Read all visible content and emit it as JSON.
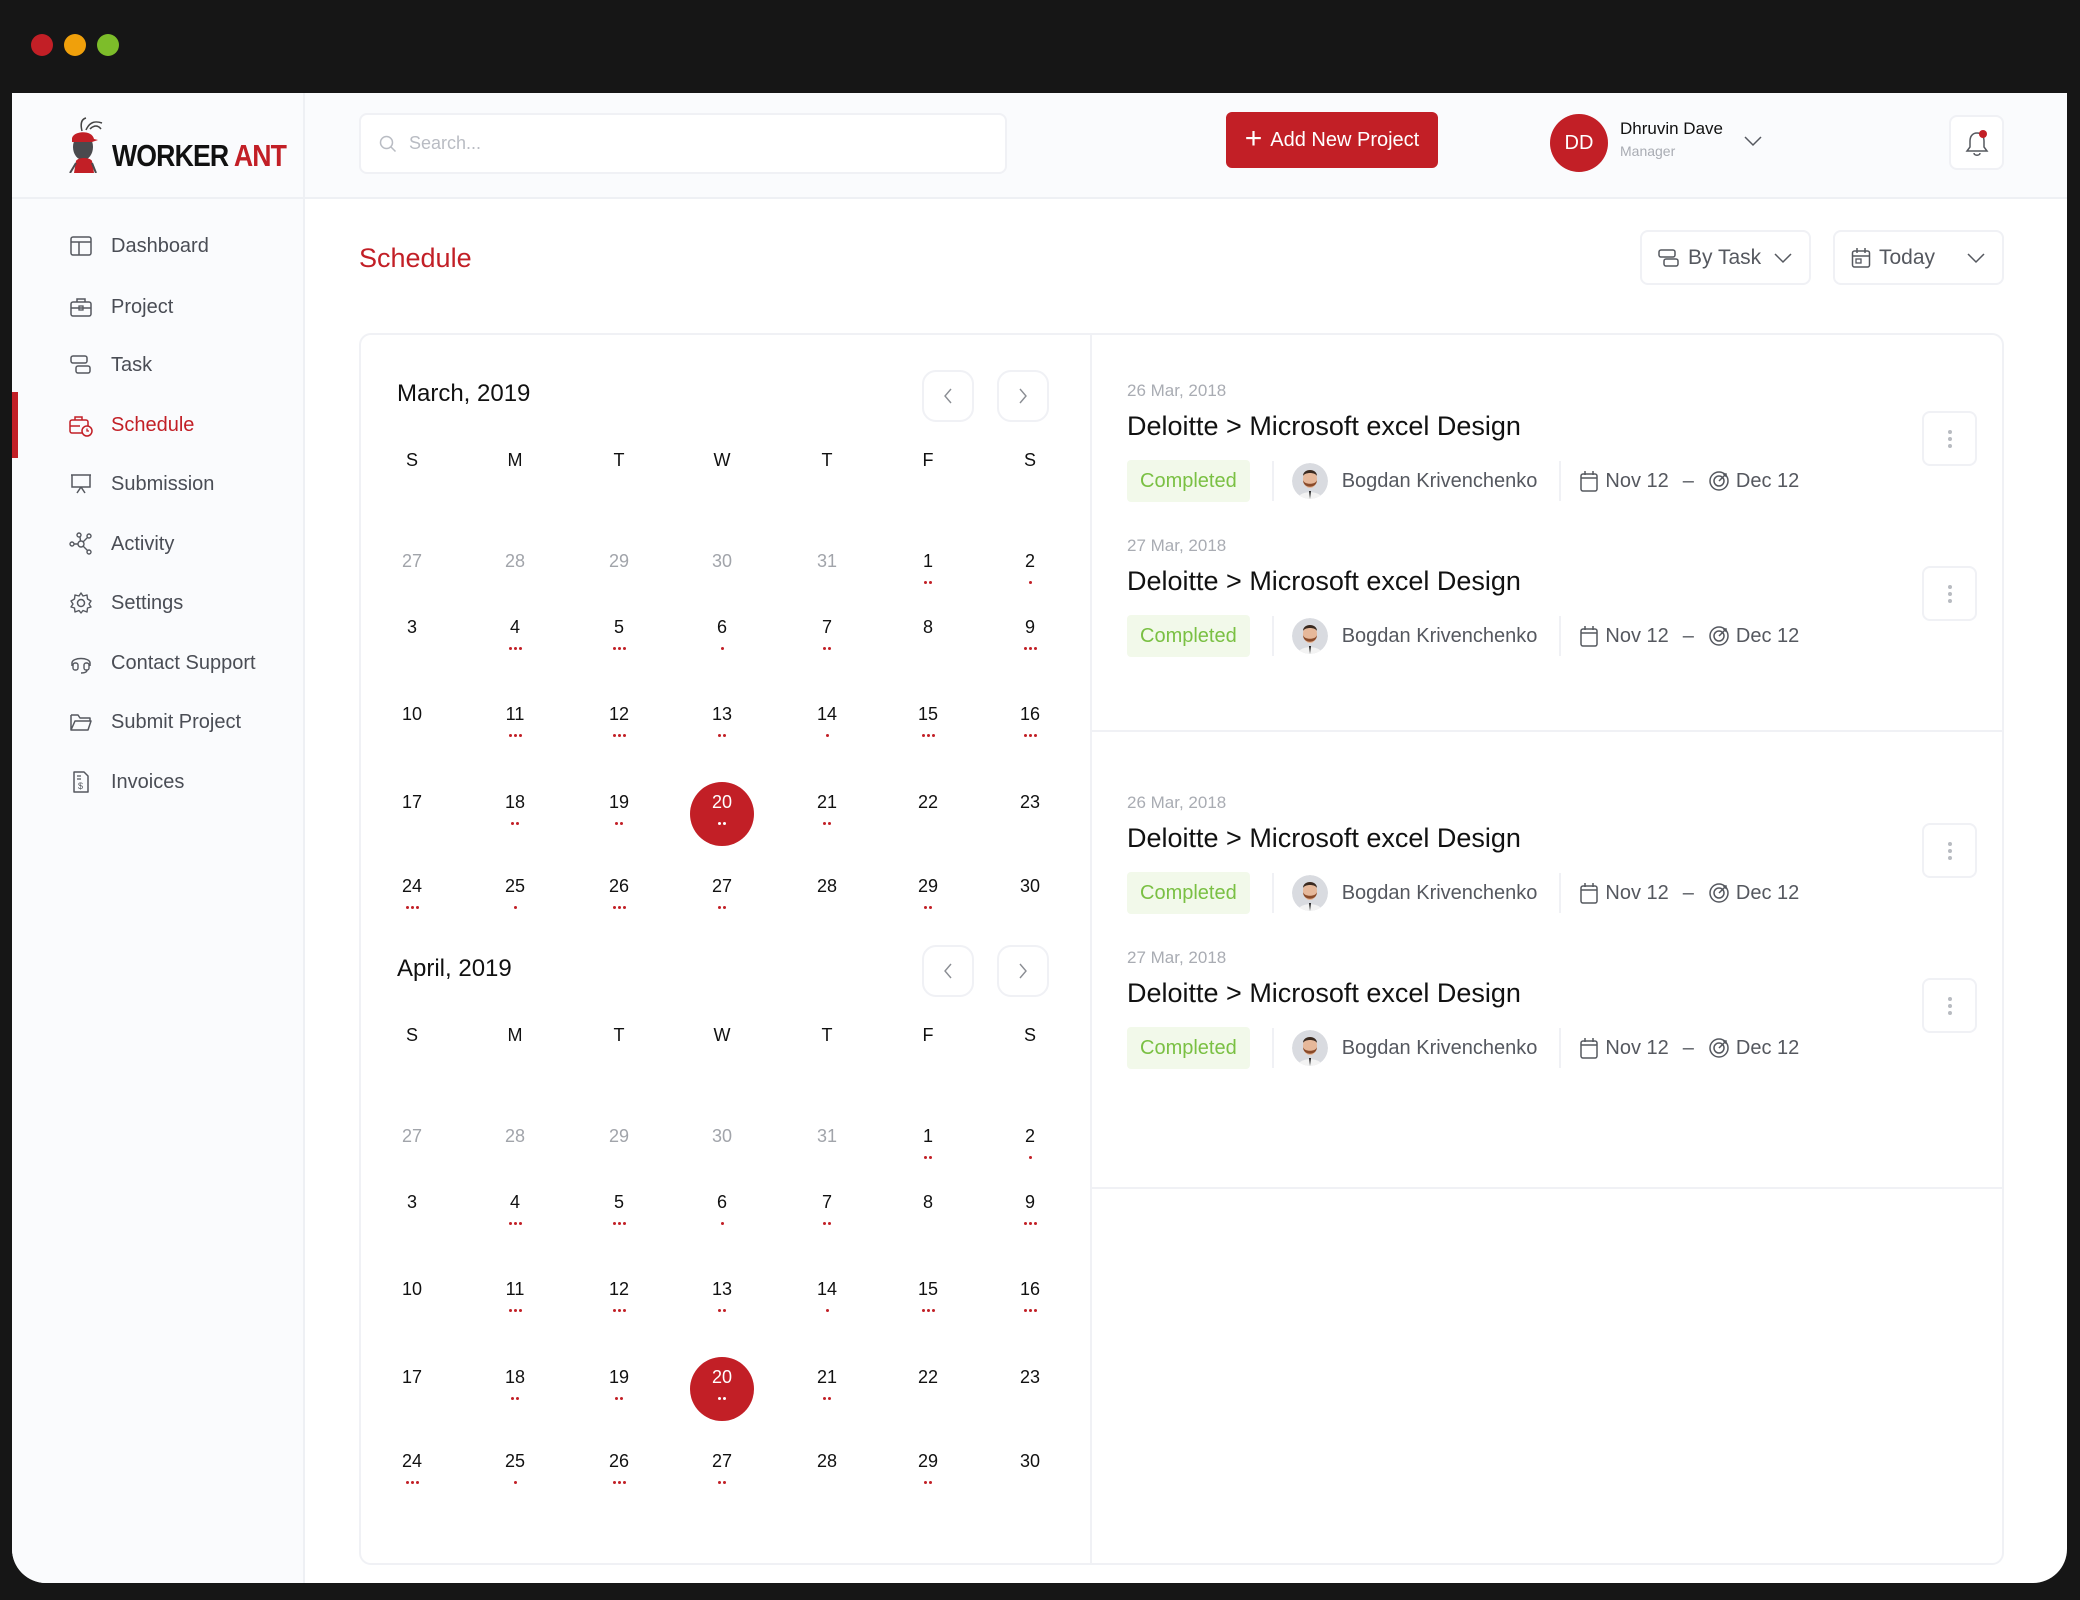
{
  "window": {
    "traffic_lights": [
      {
        "name": "close",
        "color": "#c21f26"
      },
      {
        "name": "minimize",
        "color": "#f0a00b"
      },
      {
        "name": "maximize",
        "color": "#7dbd2a"
      }
    ]
  },
  "brand": {
    "name_part1": "WORKER",
    "name_part2": "ANT",
    "accent": "#c21f26"
  },
  "header": {
    "search_placeholder": "Search...",
    "add_button_label": "Add New Project",
    "user": {
      "initials": "DD",
      "name": "Dhruvin Dave",
      "role": "Manager"
    },
    "notifications_unread": true
  },
  "sidebar": {
    "active": "Schedule",
    "items": [
      {
        "label": "Dashboard",
        "icon": "dashboard-icon"
      },
      {
        "label": "Project",
        "icon": "briefcase-icon"
      },
      {
        "label": "Task",
        "icon": "task-icon"
      },
      {
        "label": "Schedule",
        "icon": "schedule-icon"
      },
      {
        "label": "Submission",
        "icon": "presentation-icon"
      },
      {
        "label": "Activity",
        "icon": "network-icon"
      },
      {
        "label": "Settings",
        "icon": "gear-icon"
      },
      {
        "label": "Contact Support",
        "icon": "headset-icon"
      },
      {
        "label": "Submit Project",
        "icon": "folder-icon"
      },
      {
        "label": "Invoices",
        "icon": "invoice-icon"
      }
    ]
  },
  "main": {
    "title": "Schedule",
    "filters": {
      "group_by": "By Task",
      "range": "Today"
    }
  },
  "calendar": {
    "weekdays": [
      "S",
      "M",
      "T",
      "W",
      "T",
      "F",
      "S"
    ],
    "months": [
      {
        "title": "March, 2019",
        "selected_day": 20,
        "leading_days": [
          27,
          28,
          29,
          30,
          31
        ],
        "days_in_month": 30,
        "event_dots": {
          "1": 2,
          "2": 1,
          "4": 3,
          "5": 3,
          "6": 1,
          "7": 2,
          "9": 3,
          "11": 3,
          "12": 3,
          "13": 2,
          "14": 1,
          "15": 3,
          "16": 3,
          "18": 2,
          "19": 2,
          "20": 2,
          "21": 2,
          "24": 3,
          "25": 1,
          "26": 3,
          "27": 2,
          "29": 2
        }
      },
      {
        "title": "April, 2019",
        "selected_day": 20,
        "leading_days": [
          27,
          28,
          29,
          30,
          31
        ],
        "days_in_month": 30,
        "event_dots": {
          "1": 2,
          "2": 1,
          "4": 3,
          "5": 3,
          "6": 1,
          "7": 2,
          "9": 3,
          "11": 3,
          "12": 3,
          "13": 2,
          "14": 1,
          "15": 3,
          "16": 3,
          "18": 2,
          "19": 2,
          "20": 2,
          "21": 2,
          "24": 3,
          "25": 1,
          "26": 3,
          "27": 2,
          "29": 2
        }
      }
    ]
  },
  "tasks": [
    {
      "date": "26 Mar, 2018",
      "title": "Deloitte > Microsoft excel Design",
      "status": "Completed",
      "assignee": "Bogdan Krivenchenko",
      "start": "Nov 12",
      "end": "Dec 12"
    },
    {
      "date": "27 Mar, 2018",
      "title": "Deloitte > Microsoft excel Design",
      "status": "Completed",
      "assignee": "Bogdan Krivenchenko",
      "start": "Nov 12",
      "end": "Dec 12"
    },
    {
      "date": "26 Mar, 2018",
      "title": "Deloitte > Microsoft excel Design",
      "status": "Completed",
      "assignee": "Bogdan Krivenchenko",
      "start": "Nov 12",
      "end": "Dec 12"
    },
    {
      "date": "27 Mar, 2018",
      "title": "Deloitte > Microsoft excel Design",
      "status": "Completed",
      "assignee": "Bogdan Krivenchenko",
      "start": "Nov 12",
      "end": "Dec 12"
    }
  ]
}
